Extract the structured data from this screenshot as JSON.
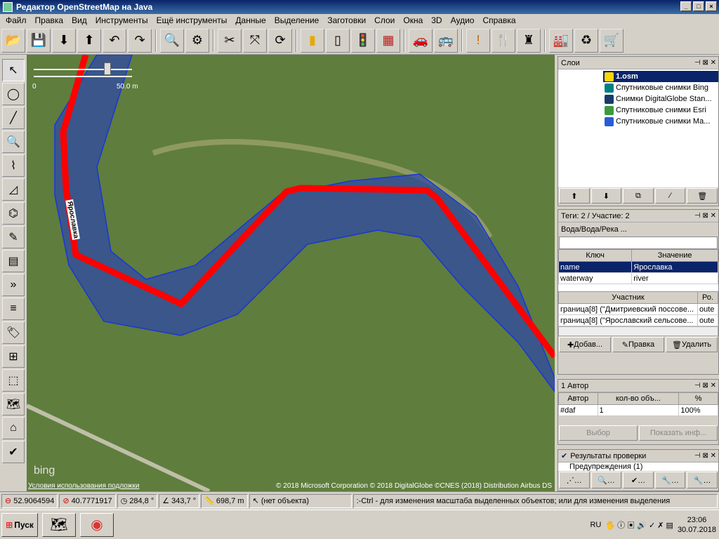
{
  "window": {
    "title": "Редактор OpenStreetMap на Java"
  },
  "menu": [
    "Файл",
    "Правка",
    "Вид",
    "Инструменты",
    "Ещё инструменты",
    "Данные",
    "Выделение",
    "Заготовки",
    "Слои",
    "Окна",
    "3D",
    "Аудио",
    "Справка"
  ],
  "map": {
    "scale_start": "0",
    "scale_end": "50.0 m",
    "river_label": "Ярославка",
    "attribution": "© 2018 Microsoft Corporation © 2018 DigitalGlobe ©CNES (2018) Distribution Airbus DS",
    "imagery_terms": "Условия использования подложки",
    "bing_logo": "bing"
  },
  "layers_panel": {
    "title": "Слои",
    "layers": [
      {
        "name": "1.osm",
        "selected": true,
        "icon_color": "#ffd700"
      },
      {
        "name": "Спутниковые снимки Bing",
        "selected": false,
        "icon_color": "#008080"
      },
      {
        "name": "Снимки DigitalGlobe Stan...",
        "selected": false,
        "icon_color": "#1a3a6a"
      },
      {
        "name": "Спутниковые снимки Esri",
        "selected": false,
        "icon_color": "#3c9a3c"
      },
      {
        "name": "Спутниковые снимки Ma...",
        "selected": false,
        "icon_color": "#2a5bd7"
      }
    ]
  },
  "tags_panel": {
    "title": "Теги: 2 / Участие: 2",
    "preset": "Вода/Вода/Река ...",
    "key_header": "Ключ",
    "value_header": "Значение",
    "tags": [
      {
        "key": "name",
        "value": "Ярославка"
      },
      {
        "key": "waterway",
        "value": "river"
      }
    ],
    "member_header": "Участник",
    "role_header": "Ро.",
    "members": [
      {
        "name": "граница[8] (\"Дмитриевский поссове...",
        "role": "oute"
      },
      {
        "name": "граница[8] (\"Ярославский сельсове...",
        "role": "oute"
      }
    ],
    "add_btn": "Добав...",
    "edit_btn": "Правка",
    "delete_btn": "Удалить"
  },
  "authors_panel": {
    "title": "1 Автор",
    "headers": [
      "Автор",
      "кол-во объ...",
      "%"
    ],
    "rows": [
      [
        "#daf",
        "1",
        "100%"
      ]
    ],
    "select_btn": "Выбор",
    "info_btn": "Показать инф..."
  },
  "validation_panel": {
    "title": "Результаты проверки",
    "warning": "Предупреждения (1)"
  },
  "status": {
    "lat": "52.9064594",
    "lon": "40.7771917",
    "heading": "284,8 °",
    "angle": "343,7 °",
    "length": "698,7 m",
    "object": "(нет объекта)",
    "hint": ":-Ctrl - для изменения масштаба выделенных объектов; или для изменения выделения"
  },
  "taskbar": {
    "start": "Пуск",
    "lang": "RU",
    "time": "23:06",
    "date": "30.07.2018"
  }
}
